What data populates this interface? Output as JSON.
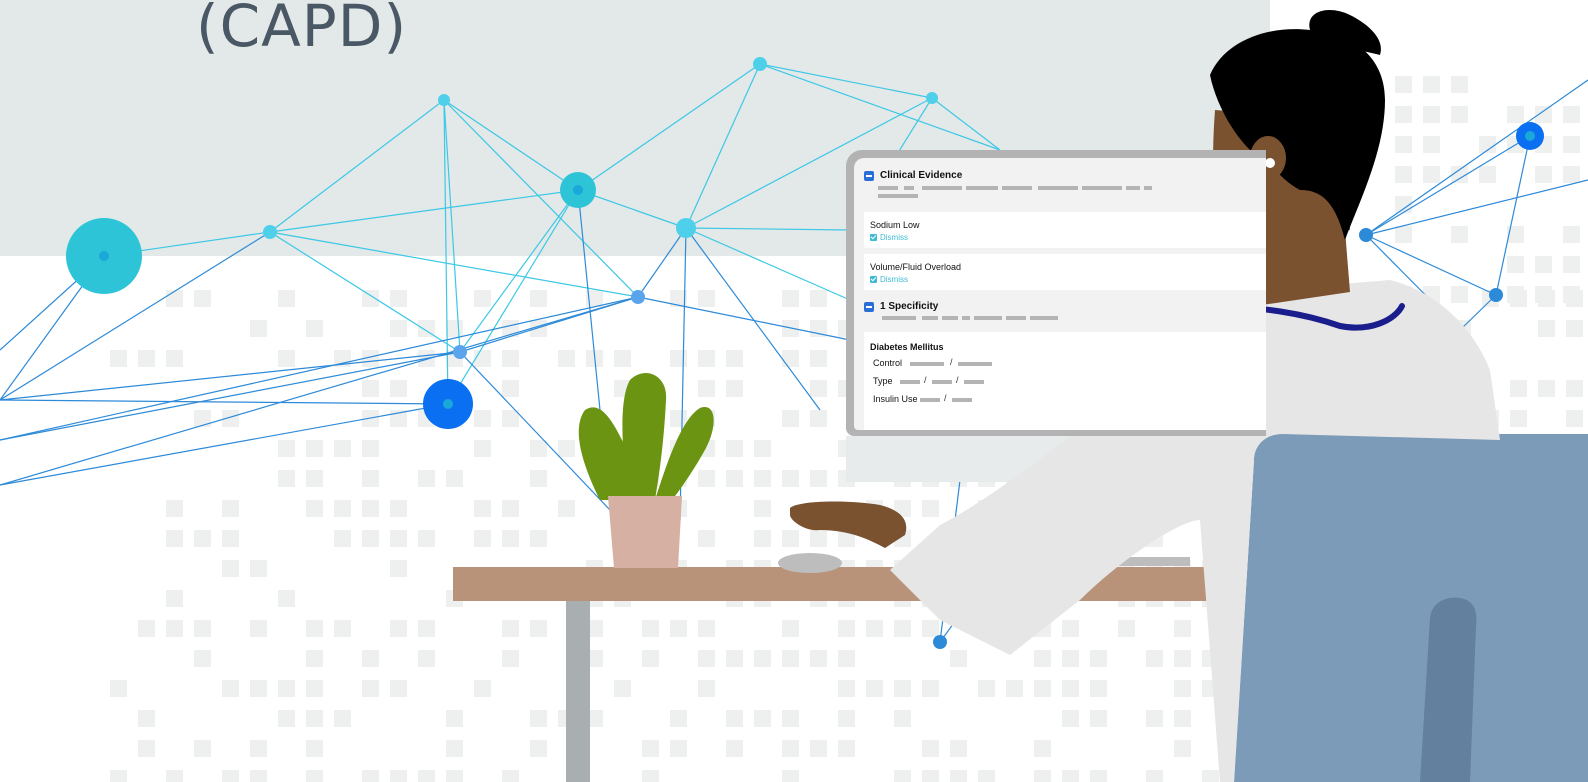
{
  "title": "(CAPD)",
  "colors": {
    "header_band": "#e3e8e8",
    "network_line": "#2d8ad8",
    "node_cyan": "#2ec4d8",
    "node_blue": "#0a6ff0",
    "desk": "#b8937a",
    "plant": "#6a9412",
    "pot": "#d6b0a2",
    "chair": "#7b9bb9",
    "skin": "#7a5230",
    "hair": "#000000",
    "coat": "#e6e6e6"
  },
  "screen": {
    "clinical_evidence": {
      "label": "Clinical Evidence",
      "items": [
        {
          "label": "Sodium Low",
          "action": "Dismiss"
        },
        {
          "label": "Volume/Fluid Overload",
          "action": "Dismiss"
        }
      ]
    },
    "specificity": {
      "label": "1 Specificity",
      "condition": "Diabetes Mellitus",
      "fields": [
        {
          "label": "Control"
        },
        {
          "label": "Type"
        },
        {
          "label": "Insulin Use"
        }
      ]
    }
  }
}
